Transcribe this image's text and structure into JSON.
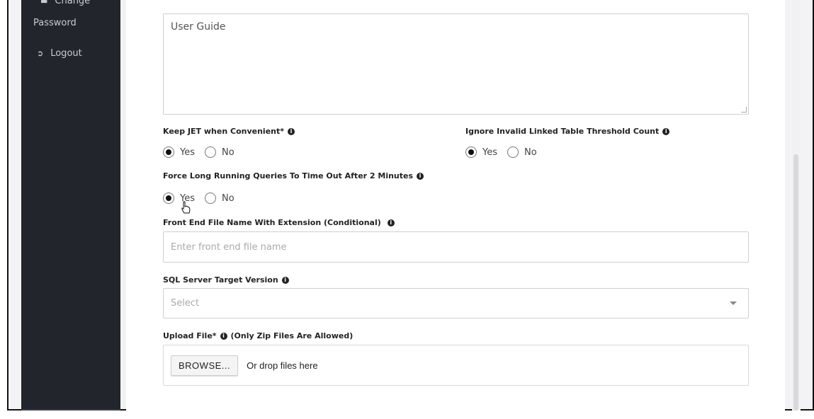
{
  "sidebar": {
    "change_label_partial": "Change",
    "password_label": "Password",
    "logout_label": "Logout",
    "logout_icon": "sign-out-icon"
  },
  "form": {
    "user_guide_placeholder": "User Guide",
    "keep_jet": {
      "label": "Keep JET when Convenient*",
      "options": [
        "Yes",
        "No"
      ],
      "selected": "Yes"
    },
    "ignore_invalid": {
      "label": "Ignore Invalid Linked Table Threshold Count",
      "options": [
        "Yes",
        "No"
      ],
      "selected": "Yes"
    },
    "force_long": {
      "label": "Force Long Running Queries To Time Out After 2 Minutes",
      "options": [
        "Yes",
        "No"
      ],
      "selected": "Yes"
    },
    "front_end": {
      "label": "Front End File Name With Extension (Conditional)",
      "placeholder": "Enter front end file name"
    },
    "sql_version": {
      "label": "SQL Server Target Version",
      "placeholder": "Select"
    },
    "upload": {
      "label": "Upload File*",
      "note": "(Only Zip Files Are Allowed)",
      "browse_label": "BROWSE...",
      "drop_text": "Or drop files here"
    }
  },
  "icons": {
    "info": "info-circle-icon",
    "cursor": "hand-pointer-icon"
  }
}
